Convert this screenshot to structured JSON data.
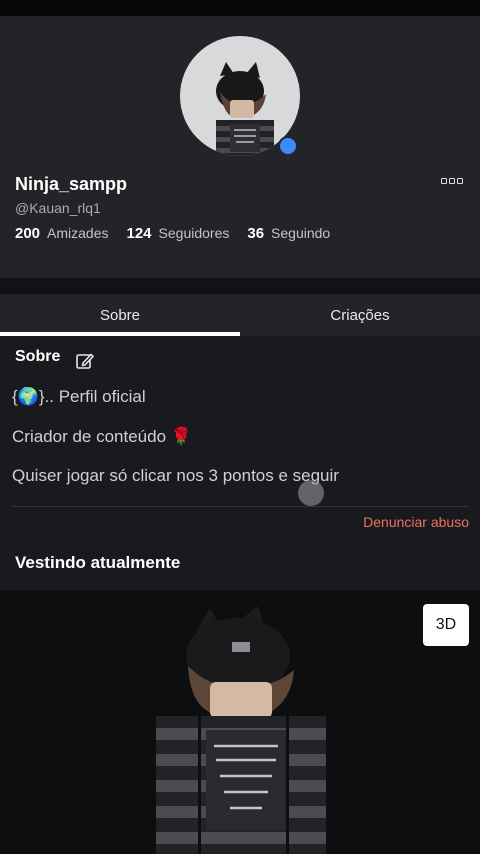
{
  "profile": {
    "display_name": "Ninja_sampp",
    "username": "@Kauan_rlq1",
    "online_status_color": "#3d8bff",
    "more_icon": "more-options-icon",
    "stats": [
      {
        "value": "200",
        "label": "Amizades"
      },
      {
        "value": "124",
        "label": "Seguidores"
      },
      {
        "value": "36",
        "label": "Seguindo"
      }
    ]
  },
  "tabs": [
    {
      "label": "Sobre",
      "active": true
    },
    {
      "label": "Criações",
      "active": false
    }
  ],
  "about": {
    "title": "Sobre",
    "edit_icon": "edit-icon",
    "bio_lines": [
      "{🌍}.. Perfil oficial",
      "Criador de conteúdo 🌹",
      "Quiser jogar só clicar nos 3 pontos e seguir"
    ],
    "report_label": "Denunciar abuso"
  },
  "wearing": {
    "title": "Vestindo atualmente",
    "view_3d_label": "3D"
  },
  "colors": {
    "header_bg": "#232428",
    "page_bg": "#111214",
    "report_color": "#f07060"
  }
}
